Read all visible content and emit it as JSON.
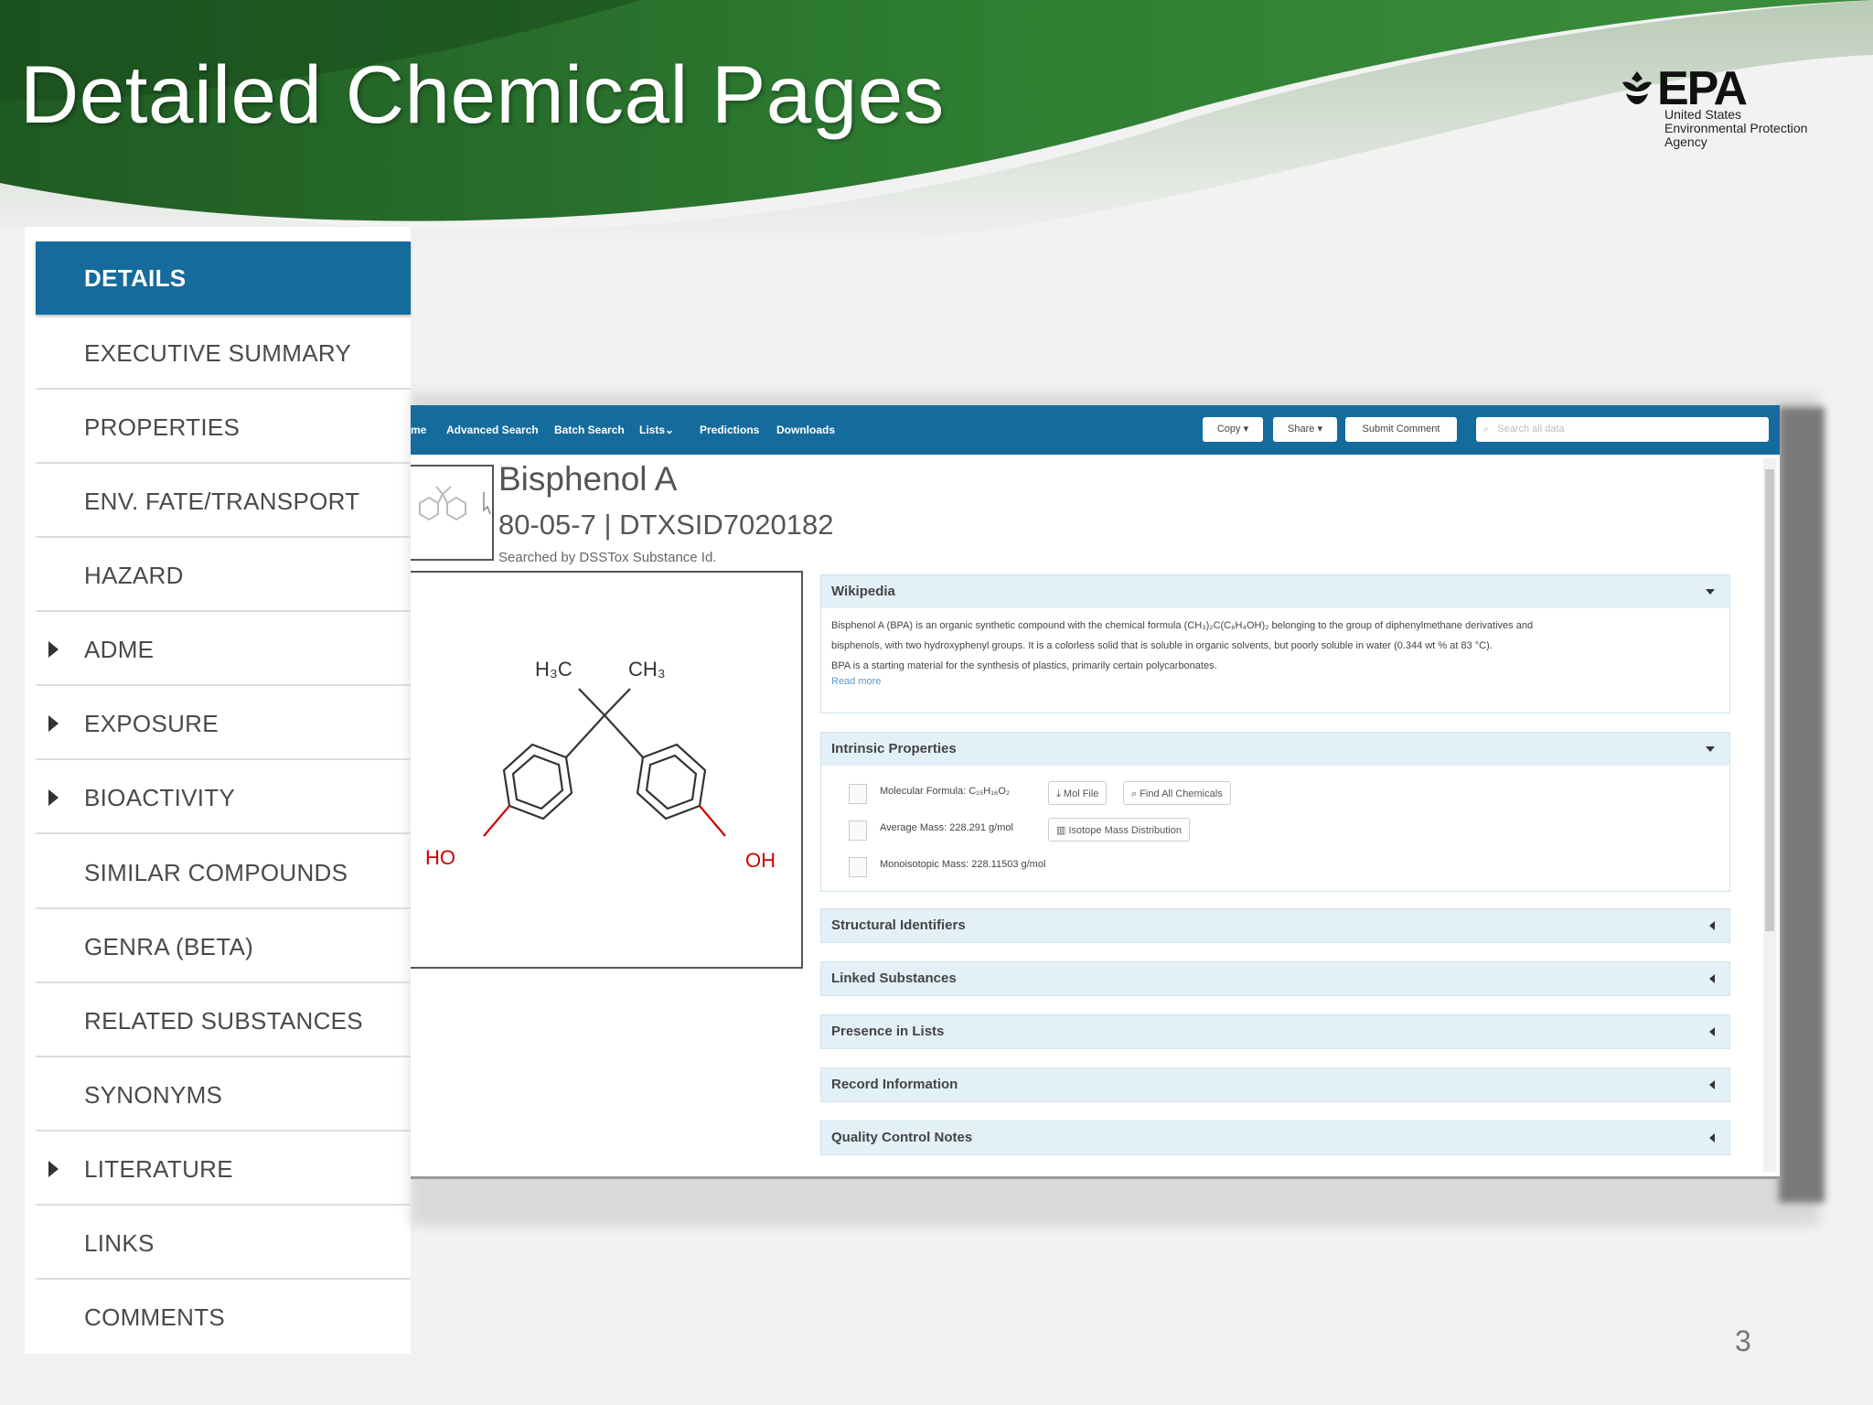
{
  "slide": {
    "title": "Detailed Chemical Pages",
    "page_number": "3"
  },
  "logo": {
    "wordmark": "EPA",
    "line1": "United States",
    "line2": "Environmental Protection",
    "line3": "Agency"
  },
  "sidebar": {
    "items": [
      {
        "label": "DETAILS",
        "active": true,
        "expandable": false
      },
      {
        "label": "EXECUTIVE SUMMARY",
        "active": false,
        "expandable": false
      },
      {
        "label": "PROPERTIES",
        "active": false,
        "expandable": false
      },
      {
        "label": "ENV. FATE/TRANSPORT",
        "active": false,
        "expandable": false
      },
      {
        "label": "HAZARD",
        "active": false,
        "expandable": false
      },
      {
        "label": "ADME",
        "active": false,
        "expandable": true
      },
      {
        "label": "EXPOSURE",
        "active": false,
        "expandable": true
      },
      {
        "label": "BIOACTIVITY",
        "active": false,
        "expandable": true
      },
      {
        "label": "SIMILAR COMPOUNDS",
        "active": false,
        "expandable": false
      },
      {
        "label": "GENRA (BETA)",
        "active": false,
        "expandable": false
      },
      {
        "label": "RELATED SUBSTANCES",
        "active": false,
        "expandable": false
      },
      {
        "label": "SYNONYMS",
        "active": false,
        "expandable": false
      },
      {
        "label": "LITERATURE",
        "active": false,
        "expandable": true
      },
      {
        "label": "LINKS",
        "active": false,
        "expandable": false
      },
      {
        "label": "COMMENTS",
        "active": false,
        "expandable": false
      }
    ],
    "active_color": "#156b9b"
  },
  "dashboard": {
    "nav": {
      "home": "me",
      "advanced_search": "Advanced Search",
      "batch_search": "Batch Search",
      "lists": "Lists",
      "predictions": "Predictions",
      "downloads": "Downloads"
    },
    "buttons": {
      "copy": "Copy ▾",
      "share": "Share ▾",
      "submit_comment": "Submit Comment"
    },
    "search_placeholder": "Search all data",
    "chemical": {
      "name": "Bisphenol A",
      "ids": "80-05-7 | DTXSID7020182",
      "searched_by": "Searched by DSSTox Substance Id."
    },
    "structure_labels": {
      "h3c": "H₃C",
      "ch3": "CH₃",
      "ho": "HO",
      "oh": "OH"
    },
    "panels": {
      "wikipedia": {
        "title": "Wikipedia",
        "line1": "Bisphenol A (BPA) is an organic synthetic compound with the chemical formula (CH₃)₂C(C₆H₄OH)₂ belonging to the group of diphenylmethane derivatives and",
        "line2": "bisphenols, with two hydroxyphenyl groups. It is a colorless solid that is soluble in organic solvents, but poorly soluble in water (0.344 wt % at 83 °C).",
        "line3": "BPA is a starting material for the synthesis of plastics, primarily certain polycarbonates.",
        "read_more": "Read more"
      },
      "intrinsic": {
        "title": "Intrinsic Properties",
        "formula_label": "Molecular Formula: C₁₅H₁₆O₂",
        "mol_file": "⤓ Mol File",
        "find_all": "⌕ Find All Chemicals",
        "avg_mass": "Average Mass: 228.291 g/mol",
        "isotope": "▥ Isotope Mass Distribution",
        "mono_mass": "Monoisotopic Mass: 228.11503 g/mol"
      },
      "collapsed": [
        "Structural Identifiers",
        "Linked Substances",
        "Presence in Lists",
        "Record Information",
        "Quality Control Notes"
      ]
    }
  }
}
